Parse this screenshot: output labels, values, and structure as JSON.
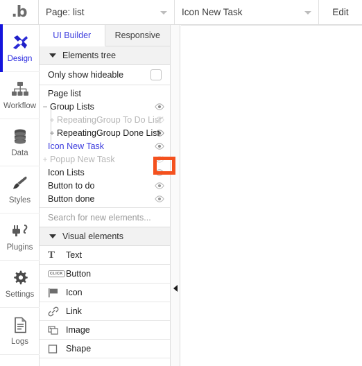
{
  "topbar": {
    "logo": "bubble-logo",
    "logo_text": ".b",
    "page_selector": {
      "value": "Page: list",
      "icon": "chevron-down-icon"
    },
    "element_selector": {
      "value": "Icon New Task",
      "icon": "chevron-down-icon"
    },
    "edit_label": "Edit"
  },
  "rail": {
    "items": [
      {
        "label": "Design",
        "icon": "design-icon",
        "active": true
      },
      {
        "label": "Workflow",
        "icon": "workflow-icon",
        "active": false
      },
      {
        "label": "Data",
        "icon": "data-icon",
        "active": false
      },
      {
        "label": "Styles",
        "icon": "styles-icon",
        "active": false
      },
      {
        "label": "Plugins",
        "icon": "plugins-icon",
        "active": false
      },
      {
        "label": "Settings",
        "icon": "settings-icon",
        "active": false
      },
      {
        "label": "Logs",
        "icon": "logs-icon",
        "active": false
      }
    ]
  },
  "panel": {
    "tabs": [
      {
        "label": "UI Builder",
        "active": true
      },
      {
        "label": "Responsive",
        "active": false
      }
    ],
    "elements_tree": {
      "title": "Elements tree",
      "collapse_icon": "triangle-down-icon",
      "only_show_hideable": {
        "label": "Only show hideable",
        "checked": false
      },
      "nodes": [
        {
          "label": "Page list",
          "indent": 0,
          "expander": "",
          "state": "normal",
          "eye": "none"
        },
        {
          "label": "Group Lists",
          "indent": 0,
          "expander": "−",
          "state": "normal",
          "eye": "visible"
        },
        {
          "label": "RepeatingGroup To Do List",
          "indent": 1,
          "expander": "+",
          "state": "dim",
          "eye": "hidden"
        },
        {
          "label": "RepeatingGroup Done List",
          "indent": 1,
          "expander": "+",
          "state": "normal",
          "eye": "visible"
        },
        {
          "label": "Icon New Task",
          "indent": 0,
          "expander": "",
          "state": "selected",
          "eye": "visible"
        },
        {
          "label": "Popup New Task",
          "indent": 0,
          "expander": "+",
          "state": "dim",
          "eye": "hidden"
        },
        {
          "label": "Icon Lists",
          "indent": 0,
          "expander": "",
          "state": "normal",
          "eye": "visible"
        },
        {
          "label": "Button to do",
          "indent": 0,
          "expander": "",
          "state": "normal",
          "eye": "visible"
        },
        {
          "label": "Button done",
          "indent": 0,
          "expander": "",
          "state": "normal",
          "eye": "visible"
        }
      ]
    },
    "search": {
      "placeholder": "Search for new elements...",
      "value": ""
    },
    "visual_elements": {
      "title": "Visual elements",
      "collapse_icon": "triangle-down-icon",
      "items": [
        {
          "label": "Text",
          "icon": "text-icon"
        },
        {
          "label": "Button",
          "icon": "button-icon"
        },
        {
          "label": "Icon",
          "icon": "flag-icon"
        },
        {
          "label": "Link",
          "icon": "link-icon"
        },
        {
          "label": "Image",
          "icon": "image-icon"
        },
        {
          "label": "Shape",
          "icon": "shape-icon"
        }
      ]
    }
  },
  "gutter": {
    "collapse_icon": "triangle-left-icon"
  },
  "highlight": {
    "target": "eye-icon-popup-new-task",
    "color": "#f4511e"
  },
  "colors": {
    "accent_blue": "#3b3bdd",
    "rail_active": "#1414dc",
    "highlight_orange": "#f4511e",
    "panel_bg": "#ffffff",
    "section_bg": "#f2f2f2",
    "border": "#dcdcdc"
  }
}
